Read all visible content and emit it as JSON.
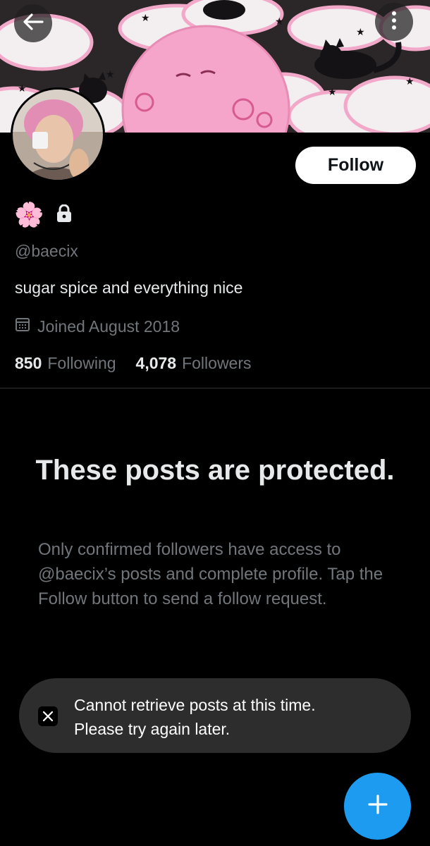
{
  "header": {
    "back_icon": "arrow-left-icon",
    "more_icon": "more-vertical-icon"
  },
  "profile": {
    "display_name_emoji": "🌸",
    "protected_icon": "lock-icon",
    "handle": "@baecix",
    "bio": "sugar spice and everything nice",
    "joined": "Joined August 2018",
    "following_count": "850",
    "following_label": "Following",
    "followers_count": "4,078",
    "followers_label": "Followers"
  },
  "follow_button": {
    "label": "Follow"
  },
  "protected_notice": {
    "title": "These posts are protected.",
    "body": "Only confirmed followers have access to @baecix’s posts and complete profile. Tap the Follow button to send a follow request."
  },
  "toast": {
    "icon": "x-logo-icon",
    "line1": "Cannot retrieve posts at this time.",
    "line2": "Please try again later."
  },
  "fab": {
    "icon": "plus-icon"
  },
  "colors": {
    "background": "#000000",
    "accent": "#1d9bf0",
    "secondary_text": "#71767b",
    "toast_bg": "#2d2d2d"
  }
}
